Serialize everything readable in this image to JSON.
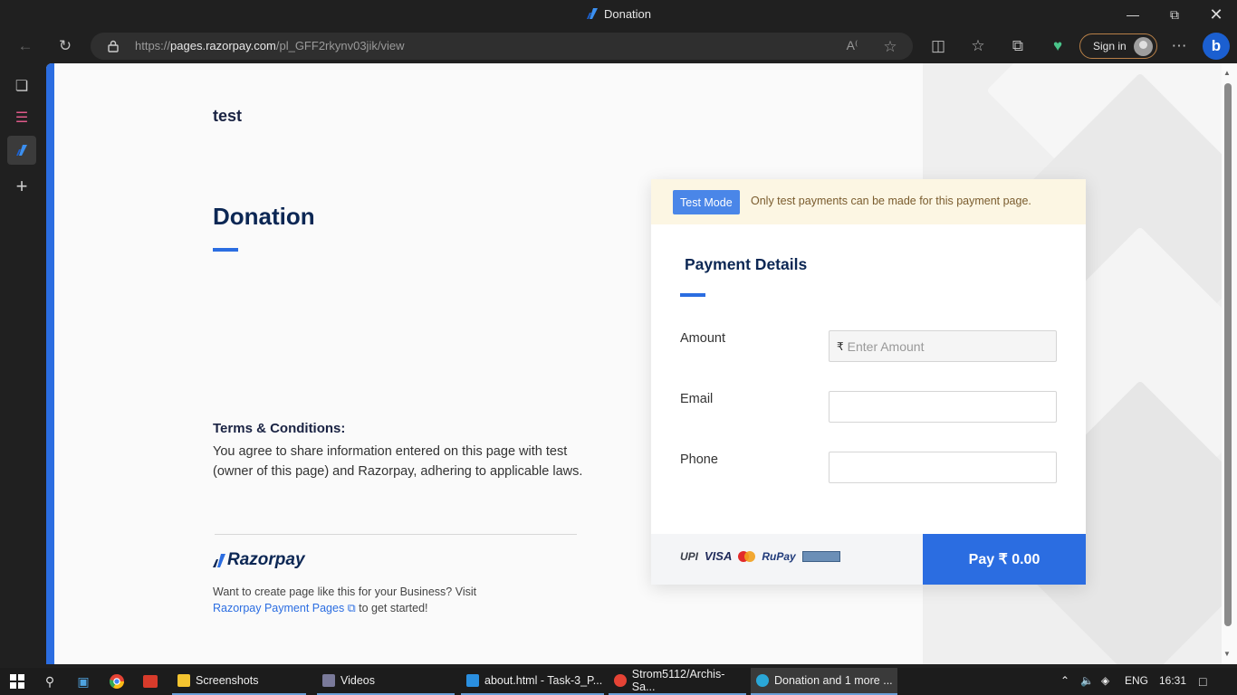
{
  "window": {
    "title": "Donation",
    "minimize_icon": "minimize-icon",
    "maximize_icon": "restore-icon",
    "close_icon": "close-icon"
  },
  "browser": {
    "url_prefix": "https://",
    "url_host": "pages.razorpay.com",
    "url_path": "/pl_GFF2rkynv03jik/view",
    "signin_label": "Sign in"
  },
  "page": {
    "brand_name": "test",
    "title": "Donation",
    "terms_heading": "Terms & Conditions:",
    "terms_body": "You agree to share information entered on this page with test (owner of this page) and Razorpay, adhering to applicable laws.",
    "logo_text": "Razorpay",
    "promo_text": "Want to create page like this for your Business? Visit",
    "promo_link": "Razorpay Payment Pages",
    "promo_suffix": "to get started!"
  },
  "payment_card": {
    "test_badge": "Test Mode",
    "test_message": "Only test payments can be made for this payment page.",
    "heading": "Payment Details",
    "fields": {
      "amount_label": "Amount",
      "amount_placeholder": "Enter Amount",
      "currency_symbol": "₹",
      "email_label": "Email",
      "phone_label": "Phone"
    },
    "payment_marks": [
      "UPI",
      "VISA",
      "RuPay"
    ],
    "pay_button": "Pay  ₹ 0.00"
  },
  "taskbar": {
    "apps": [
      {
        "label": "Screenshots"
      },
      {
        "label": "Videos"
      },
      {
        "label": "about.html - Task-3_P..."
      },
      {
        "label": "Strom5112/Archis-Sa..."
      },
      {
        "label": "Donation and 1 more ..."
      }
    ],
    "language": "ENG",
    "time": "16:31"
  },
  "colors": {
    "accent": "#2b6de1",
    "navy": "#0c2754",
    "test_bar": "#fcf6e3"
  }
}
